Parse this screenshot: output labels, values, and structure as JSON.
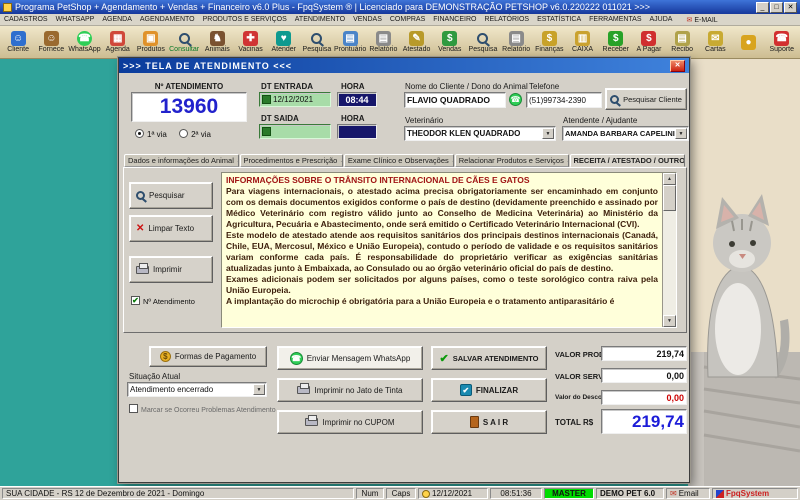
{
  "window": {
    "title": "Programa PetShop + Agendamento + Vendas + Financeiro v6.0 Plus - FpqSystem ® | Licenciado para DEMONSTRAÇÃO PETSHOP v6.0.220222 011021   >>>"
  },
  "icons": {
    "minimize": "_",
    "maximize": "□",
    "close": "✕",
    "phone": "☎",
    "mail": "✉",
    "check": "✔",
    "x_mark": "✕",
    "down_arrow": "▼",
    "up_arrow": "▲",
    "dollar": "$"
  },
  "menu": {
    "email_icon": "✉",
    "items": [
      "CADASTROS",
      "WHATSAPP",
      "AGENDA",
      "AGENDAMENTO",
      "PRODUTOS E SERVIÇOS",
      "ATENDIMENTO",
      "VENDAS",
      "COMPRAS",
      "FINANCEIRO",
      "RELATÓRIOS",
      "ESTATÍSTICA",
      "FERRAMENTAS",
      "AJUDA",
      "E-MAIL"
    ]
  },
  "toolbar": {
    "items": [
      {
        "label": "Cliente",
        "icon": "client-icon",
        "glyph": "☺",
        "color": "#2f6fce"
      },
      {
        "label": "Fornece",
        "icon": "supplier-icon",
        "glyph": "☺",
        "color": "#9a6a2f"
      },
      {
        "label": "WhatsApp",
        "icon": "whatsapp-icon",
        "glyph": "☎",
        "color": "#2fce57",
        "shape": "circle"
      },
      {
        "label": "Agenda",
        "icon": "calendar-icon",
        "glyph": "▦",
        "color": "#d0483a"
      },
      {
        "label": "Produtos",
        "icon": "products-icon",
        "glyph": "▣",
        "color": "#e0922a"
      },
      {
        "label": "Consultar",
        "icon": "search-icon",
        "shape": "mag",
        "label_color": "#0a7a2a"
      },
      {
        "label": "Animais",
        "icon": "animals-icon",
        "glyph": "♞",
        "color": "#7a5230"
      },
      {
        "label": "Vacinas",
        "icon": "syringe-icon",
        "glyph": "✚",
        "color": "#d03434"
      },
      {
        "label": "Atender",
        "icon": "stethoscope-icon",
        "glyph": "♥",
        "color": "#0f9a8f"
      },
      {
        "label": "Pesquisa",
        "icon": "search-icon",
        "shape": "mag"
      },
      {
        "label": "Prontuário",
        "icon": "medical-record-icon",
        "glyph": "▤",
        "color": "#4a84c8"
      },
      {
        "label": "Relatório",
        "icon": "report-icon",
        "glyph": "▤",
        "color": "#8a8a8a"
      },
      {
        "label": "Atestado",
        "icon": "certificate-icon",
        "glyph": "✎",
        "color": "#b89a2a"
      },
      {
        "label": "Vendas",
        "icon": "sales-icon",
        "glyph": "$",
        "color": "#2f9a3f"
      },
      {
        "label": "Pesquisa",
        "icon": "search-icon",
        "shape": "mag"
      },
      {
        "label": "Relatório",
        "icon": "report-icon",
        "glyph": "▤",
        "color": "#8a8a8a"
      },
      {
        "label": "Finanças",
        "icon": "finance-icon",
        "glyph": "$",
        "color": "#c8a22a"
      },
      {
        "label": "CAIXA",
        "icon": "cash-register-icon",
        "glyph": "▥",
        "color": "#caa22f"
      },
      {
        "label": "Receber",
        "icon": "receive-money-icon",
        "glyph": "$",
        "color": "#28a228"
      },
      {
        "label": "A Pagar",
        "icon": "pay-money-icon",
        "glyph": "$",
        "color": "#d02f2f"
      },
      {
        "label": "Recibo",
        "icon": "receipt-icon",
        "glyph": "▤",
        "color": "#b0a24a"
      },
      {
        "label": "Cartas",
        "icon": "letters-icon",
        "glyph": "✉",
        "color": "#c8aa32"
      },
      {
        "label": "",
        "icon": "coins-icon",
        "glyph": "●",
        "color": "#d8a41f"
      },
      {
        "label": "Suporte",
        "icon": "support-icon",
        "glyph": "☎",
        "color": "#d22f2f"
      }
    ]
  },
  "dialog": {
    "title": ">>>   TELA DE ATENDIMENTO   <<<",
    "header": {
      "atendimento_label": "Nº ATENDIMENTO",
      "atendimento_numero": "13960",
      "via1": "1ª via",
      "via2": "2ª via",
      "via_selecionada": "1ª via",
      "dt_entrada_label": "DT ENTRADA",
      "dt_entrada": "12/12/2021",
      "hora_entrada_label": "HORA",
      "hora_entrada": "08:44",
      "dt_saida_label": "DT SAIDA",
      "dt_saida": "",
      "hora_saida_label": "HORA",
      "hora_saida": "",
      "cliente_label": "Nome do Cliente / Dono do Animal",
      "cliente": "FLAVIO QUADRADO",
      "telefone_label": "Telefone",
      "telefone": "(51)99734-2390",
      "pesquisar_cliente": "Pesquisar Cliente",
      "veterinario_label": "Veterinário",
      "veterinario": "THEODOR KLEN QUADRADO",
      "atendente_label": "Atendente / Ajudante",
      "atendente": "AMANDA BARBARA CAPELINI"
    },
    "tabs": [
      "Dados e informações do Animal  →",
      "Procedimentos e Prescrição  →",
      "Exame Clínico e Observações  →",
      "Relacionar Produtos e Serviços  →",
      "RECEITA / ATESTADO / OUTROS"
    ],
    "active_tab": 4,
    "side": {
      "pesquisar": "Pesquisar",
      "limpar": "Limpar Texto",
      "imprimir": "Imprimir",
      "num_atendimento": "Nº Atendimento",
      "num_atendimento_check": "✔"
    },
    "texto": {
      "titulo": "INFORMAÇÕES SOBRE O TRÂNSITO INTERNACIONAL DE CÃES E GATOS",
      "paragraphs": [
        "Para viagens internacionais, o atestado acima precisa obrigatoriamente ser encaminhado em conjunto com os demais documentos exigidos conforme o país de destino (devidamente preenchido e assinado por Médico Veterinário com registro válido junto ao Conselho de Medicina Veterinária) ao Ministério da Agricultura, Pecuária e Abastecimento, onde será emitido o Certificado Veterinário Internacional (CVI).",
        "Este modelo de atestado atende aos requisitos sanitários dos principais destinos internacionais (Canadá, Chile, EUA, Mercosul, México e União Europeia), contudo o período de validade e os requisitos sanitários variam conforme cada país. É responsabilidade do proprietário verificar as exigências sanitárias atualizadas junto à Embaixada, ao Consulado ou ao órgão veterinário oficial do país de destino.",
        "Exames adicionais podem ser solicitados por alguns países, como o teste sorológico contra raiva pela União Europeia.",
        "A implantação do microchip é obrigatória para a União Europeia e o tratamento antiparasitário é"
      ]
    },
    "rodape": {
      "formas_pagamento": "Formas de Pagamento",
      "situacao_label": "Situação Atual",
      "situacao": "Atendimento encerrado",
      "problemas": "Marcar se Ocorreu Problemas Atendimento",
      "problemas_check": "",
      "whatsapp": "Enviar Mensagem WhatsApp",
      "jato": "Imprimir no Jato de Tinta",
      "cupom": "Imprimir no CUPOM",
      "salvar": "SALVAR  ATENDIMENTO",
      "finalizar": "FINALIZAR",
      "sair": "S A I R",
      "valor_produtos_label": "VALOR PRODUTOS",
      "valor_produtos": "219,74",
      "valor_servicos_label": "VALOR SERVIÇOS",
      "valor_servicos": "0,00",
      "desconto_label": "Valor do Desconto ( - )",
      "desconto": "0,00",
      "total_label": "TOTAL R$",
      "total": "219,74"
    }
  },
  "statusbar": {
    "cidade": "SUA CIDADE - RS 12 de Dezembro de 2021 - Domingo",
    "num": "Num",
    "caps": "Caps",
    "data": "12/12/2021",
    "hora": "08:51:36",
    "master": "MASTER",
    "versao": "DEMO PET 6.0",
    "email": "Email",
    "marca": "FpqSystem"
  },
  "colors": {
    "accent_blue": "#1c1cd8",
    "money_red": "#cc0000",
    "master_green": "#00dc00",
    "whatsapp_green": "#2fce57",
    "desktop_teal": "#2fa39a"
  }
}
